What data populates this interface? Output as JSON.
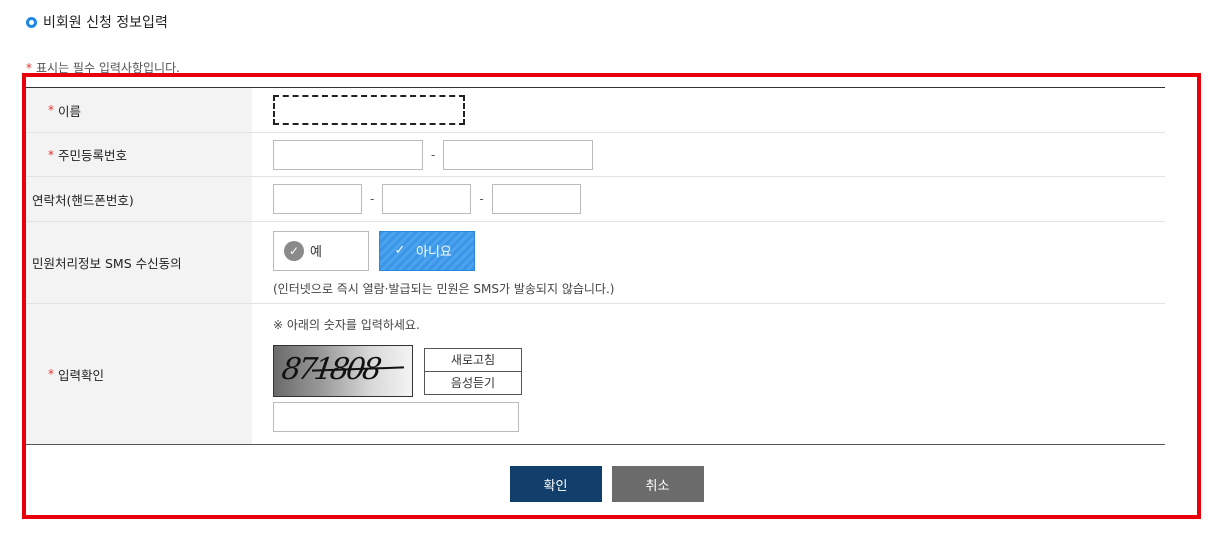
{
  "section": {
    "title": "비회원 신청 정보입력"
  },
  "required_note": {
    "star": "*",
    "text": "표시는 필수 입력사항입니다."
  },
  "form": {
    "name": {
      "label": "이름",
      "required": true
    },
    "resident_number": {
      "label": "주민등록번호",
      "required": true,
      "separator": "-"
    },
    "phone": {
      "label": "연락처(핸드폰번호)",
      "separator": "-"
    },
    "sms_consent": {
      "label": "민원처리정보 SMS 수신동의",
      "options": [
        "예",
        "아니요"
      ],
      "selected": "아니요",
      "note": "(인터넷으로 즉시 열람·발급되는 민원은 SMS가 발송되지 않습니다.)"
    },
    "captcha": {
      "label": "입력확인",
      "required": true,
      "instruction": "※ 아래의 숫자를 입력하세요.",
      "image_text": "871808",
      "refresh_label": "새로고침",
      "audio_label": "음성듣기"
    }
  },
  "buttons": {
    "confirm": "확인",
    "cancel": "취소"
  },
  "colors": {
    "accent": "#1e88e5",
    "highlight": "#e8000b",
    "confirm": "#123e6b",
    "cancel": "#6c6c6c",
    "selected_option": "#3b96e8"
  }
}
